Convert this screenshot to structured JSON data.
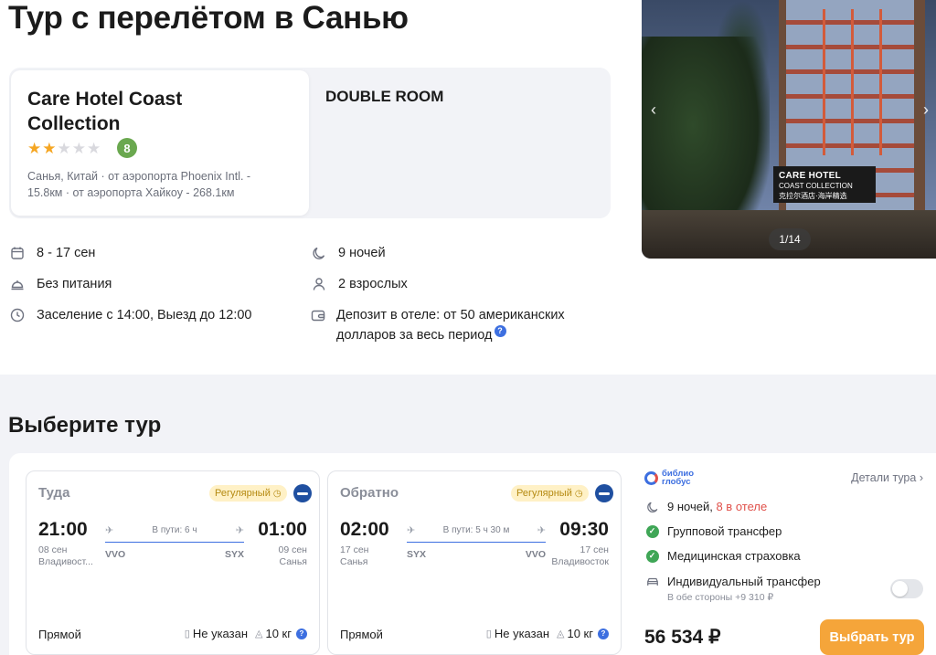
{
  "page": {
    "title": "Тур с перелётом в Санью"
  },
  "hotel": {
    "name": "Care Hotel Coast Collection",
    "stars": 2,
    "stars_max": 5,
    "rating": "8",
    "location": "Санья, Китай · от аэропорта Phoenix Intl. - 15.8км · от аэропорта Хайкоу - 268.1км",
    "room": "DOUBLE ROOM"
  },
  "photo": {
    "counter": "1/14",
    "sign_main": "CARE HOTEL",
    "sign_sub": "COAST COLLECTION",
    "sign_cn": "克拉尔酒店·海岸精选"
  },
  "details": {
    "dates": "8 - 17 сен",
    "nights": "9 ночей",
    "meal": "Без питания",
    "guests": "2 взрослых",
    "checkin": "Заселение с 14:00, Выезд до 12:00",
    "deposit": "Депозит в отеле: от 50 американских долларов за весь период",
    "help": "?"
  },
  "section": {
    "title": "Выберите тур"
  },
  "flights": [
    {
      "direction": "Туда",
      "tag": "Регулярный",
      "dep_time": "21:00",
      "dep_date": "08 сен",
      "dep_city": "Владивост...",
      "arr_time": "01:00",
      "arr_date": "09 сен",
      "arr_city": "Санья",
      "duration": "В пути: 6 ч",
      "from_code": "VVO",
      "to_code": "SYX",
      "type": "Прямой",
      "hand_bag": "Не указан",
      "luggage": "10 кг"
    },
    {
      "direction": "Обратно",
      "tag": "Регулярный",
      "dep_time": "02:00",
      "dep_date": "17 сен",
      "dep_city": "Санья",
      "arr_time": "09:30",
      "arr_date": "17 сен",
      "arr_city": "Владивосток",
      "duration": "В пути: 5 ч 30 м",
      "from_code": "SYX",
      "to_code": "VVO",
      "type": "Прямой",
      "hand_bag": "Не указан",
      "luggage": "10 кг"
    }
  ],
  "tour": {
    "operator_line1": "библио",
    "operator_line2": "глобус",
    "details_link": "Детали тура",
    "nights": "9 ночей,",
    "nights_hotel": "8 в отеле",
    "group_transfer": "Групповой трансфер",
    "insurance": "Медицинская страховка",
    "individual_transfer": "Индивидуальный трансфер",
    "individual_transfer_price": "В обе стороны +9 310 ₽",
    "individual_transfer_enabled": false,
    "price": "56 534 ₽",
    "choose_button": "Выбрать тур"
  },
  "colors": {
    "accent_orange": "#f5a53a",
    "link_blue": "#3d6fe0",
    "rating_green": "#6aa84f",
    "check_green": "#3fa656",
    "alert_red": "#e0504a",
    "tag_yellow": "#fff1c6"
  }
}
